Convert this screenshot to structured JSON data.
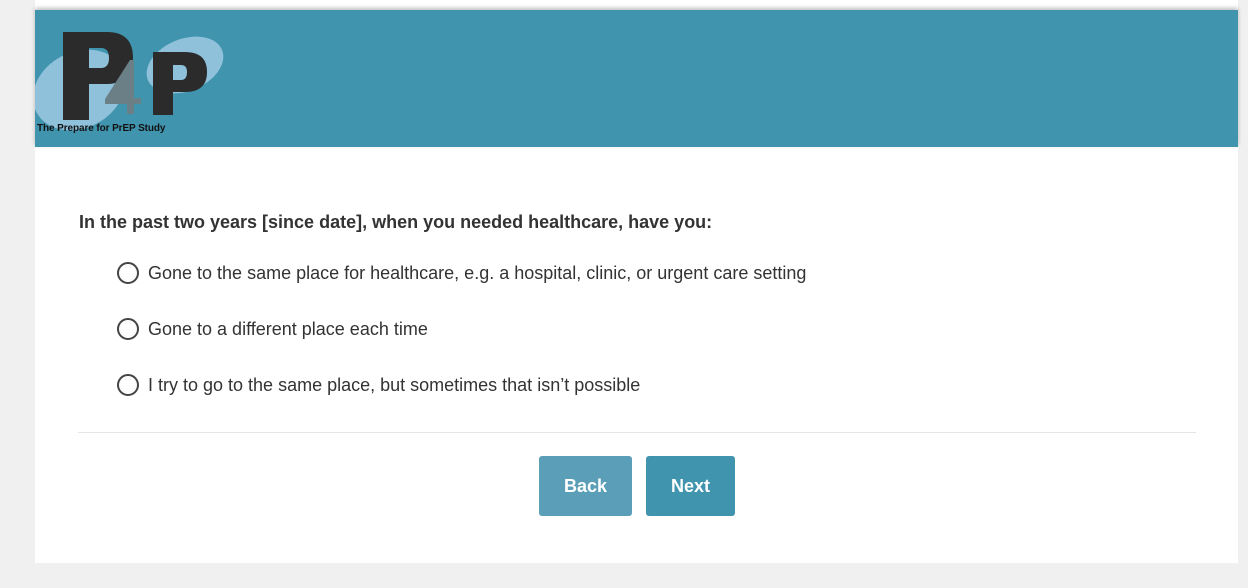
{
  "header": {
    "logo_tagline": "The Prepare for PrEP Study",
    "logo_mark": "P4P",
    "banner_color": "#4094ae"
  },
  "question": {
    "text": "In the past two years [since date], when you needed healthcare, have you:",
    "options": [
      {
        "label": "Gone to the same place for healthcare, e.g. a hospital, clinic, or urgent care setting",
        "selected": false
      },
      {
        "label": "Gone to a different place each time",
        "selected": false
      },
      {
        "label": "I try to go to the same place, but sometimes that isn’t possible",
        "selected": false
      }
    ]
  },
  "navigation": {
    "back_label": "Back",
    "next_label": "Next"
  },
  "colors": {
    "page_background": "#f0f0f0",
    "card_background": "#ffffff",
    "back_button": "#5a9fb7",
    "next_button": "#4094ae",
    "text": "#333333"
  }
}
